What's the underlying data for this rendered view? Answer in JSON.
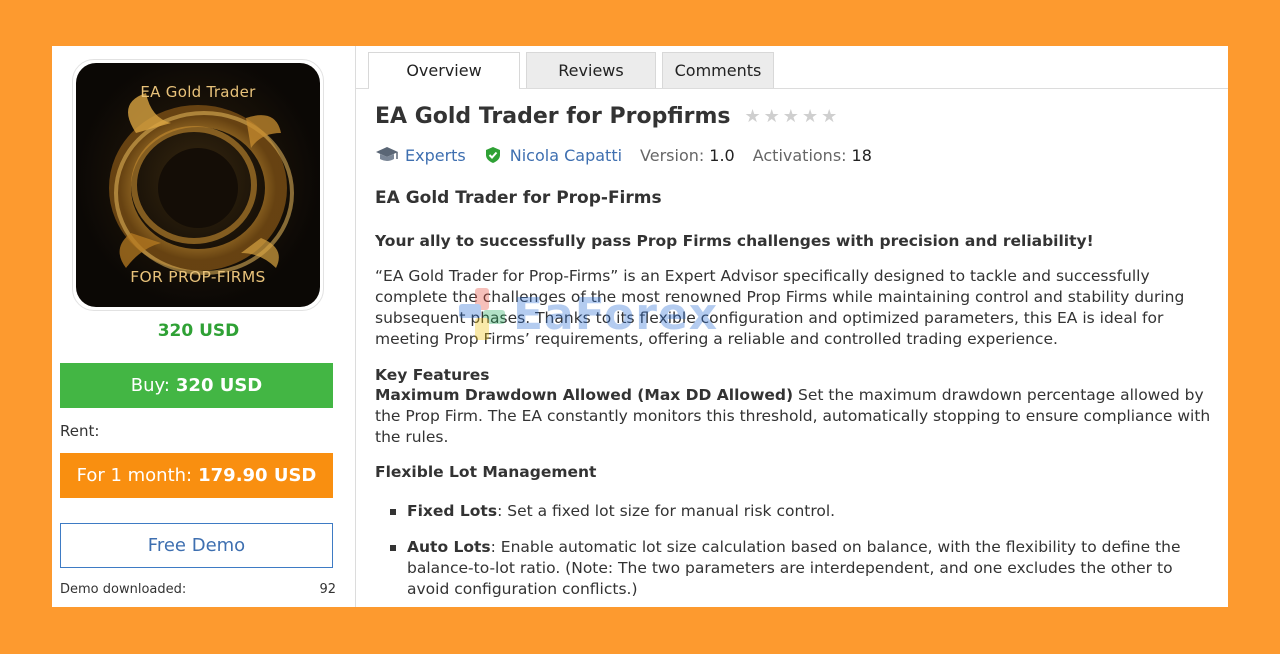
{
  "product": {
    "image_top_text": "EA Gold Trader",
    "image_bottom_text": "FOR PROP-FIRMS",
    "price": "320 USD"
  },
  "buy": {
    "label": "Buy:",
    "amount": "320 USD"
  },
  "rent": {
    "label": "Rent:",
    "button_label": "For 1 month:",
    "button_amount": "179.90 USD"
  },
  "demo": {
    "button_label": "Free Demo",
    "downloaded_label": "Demo downloaded:",
    "downloaded_count": "92"
  },
  "tabs": [
    {
      "label": "Overview",
      "active": true
    },
    {
      "label": "Reviews",
      "active": false
    },
    {
      "label": "Comments",
      "active": false
    }
  ],
  "header": {
    "title": "EA Gold Trader for Propfirms",
    "rating_stars": 0,
    "category": "Experts",
    "author": "Nicola Capatti",
    "version_label": "Version:",
    "version": "1.0",
    "activations_label": "Activations:",
    "activations": "18"
  },
  "description": {
    "subtitle": "EA Gold Trader for Prop-Firms",
    "lead": "Your ally to successfully pass Prop Firms challenges with precision and reliability!",
    "paragraph": "“EA Gold Trader for Prop-Firms” is an Expert Advisor specifically designed to tackle and successfully complete the challenges of the most renowned Prop Firms while maintaining control and stability during subsequent phases. Thanks to its flexible configuration and optimized parameters, this EA is ideal for meeting Prop Firms’ requirements, offering a reliable and controlled trading experience.",
    "key_features_heading": "Key Features",
    "max_dd_title": "Maximum Drawdown Allowed (Max DD Allowed)",
    "max_dd_text": " Set the maximum drawdown percentage allowed by the Prop Firm. The EA constantly monitors this threshold, automatically stopping to ensure compliance with the rules.",
    "lot_heading": "Flexible Lot Management",
    "bullets": [
      {
        "title": "Fixed Lots",
        "text": ": Set a fixed lot size for manual risk control."
      },
      {
        "title": "Auto Lots",
        "text": ": Enable automatic lot size calculation based on balance, with the flexibility to define the balance-to-lot ratio. (Note: The two parameters are interdependent, and one excludes the other to avoid configuration conflicts.)"
      }
    ]
  },
  "watermark": "EaForex",
  "colors": {
    "background": "#fd9a2f",
    "buy_button": "#43b644",
    "rent_button": "#f98f10",
    "price": "#2fa135",
    "link": "#3e6fb0"
  }
}
